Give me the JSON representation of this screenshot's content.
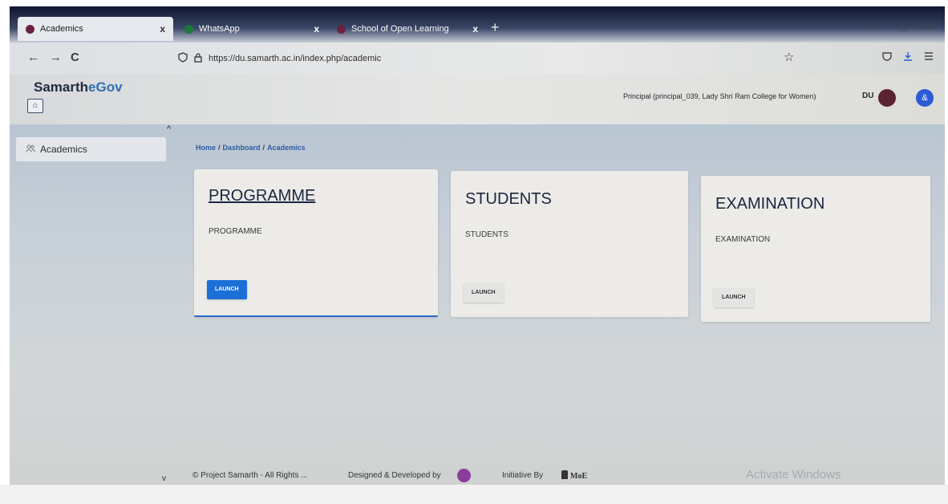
{
  "browser": {
    "tabs": [
      {
        "label": "Academics",
        "favicon_color": "#6b2340",
        "active": true
      },
      {
        "label": "WhatsApp",
        "favicon_color": "#1d7a3d",
        "active": false
      },
      {
        "label": "School of Open Learning",
        "favicon_color": "#6b2340",
        "active": false
      }
    ],
    "tab_close": "x",
    "new_tab": "+",
    "window_controls": [
      "–",
      "▢",
      "✕"
    ],
    "nav": {
      "back": "←",
      "forward": "→",
      "reload": "C"
    },
    "url": "https://du.samarth.ac.in/index.php/academic",
    "url_icons": [
      "shield-icon",
      "lock-icon"
    ],
    "bookmark_icon": "☆"
  },
  "app": {
    "brand_main": "Samarth",
    "brand_accent": "eGov",
    "home_icon": "⌂",
    "user_info": "Principal (principal_039, Lady Shri Ram College for Women)",
    "university_badge": "DU",
    "user_icon": "&"
  },
  "sidebar": {
    "collapse_icon": "^",
    "items": [
      {
        "label": "Academics",
        "icon": "users-icon"
      }
    ],
    "scroll_down_icon": "v"
  },
  "breadcrumb": {
    "items": [
      "Home",
      "Dashboard",
      "Academics"
    ],
    "separator": "/"
  },
  "cards": [
    {
      "title": "PROGRAMME",
      "description": "PROGRAMME",
      "button": "LAUNCH",
      "highlighted": true
    },
    {
      "title": "STUDENTS",
      "description": "STUDENTS",
      "button": "LAUNCH",
      "highlighted": false
    },
    {
      "title": "EXAMINATION",
      "description": "EXAMINATION",
      "button": "LAUNCH",
      "highlighted": false
    }
  ],
  "footer": {
    "copyright": "© Project Samarth - All Rights ...",
    "designed_by": "Designed & Developed by",
    "initiative": "Initiative By",
    "moe": "MoE"
  },
  "watermark": "Activate Windows",
  "colors": {
    "brand_accent": "#2f6fb4",
    "primary_button": "#1d6fd8",
    "breadcrumb": "#2e5ba0"
  }
}
